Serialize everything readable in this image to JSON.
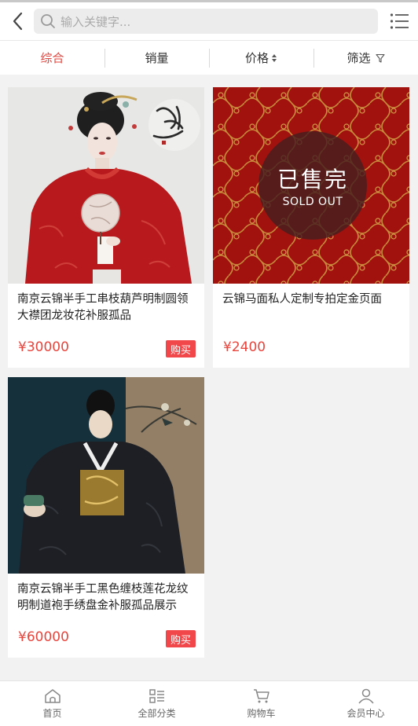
{
  "header": {
    "search_placeholder": "输入关键字..."
  },
  "sort": {
    "items": [
      "综合",
      "销量",
      "价格",
      "筛选"
    ],
    "active_color": "#e0463f"
  },
  "products": [
    {
      "title": "南京云锦半手工串枝葫芦明制圆领大襟团龙妆花补服孤品",
      "price": "¥30000",
      "buy_label": "购买"
    },
    {
      "title": "云锦马面私人定制专拍定金页面",
      "price": "¥2400",
      "sold_out_label": "已售完",
      "sold_out_en": "SOLD OUT"
    },
    {
      "title": "南京云锦半手工黑色缠枝莲花龙纹明制道袍手绣盘金补服孤品展示",
      "price": "¥60000",
      "buy_label": "购买"
    }
  ],
  "tabbar": {
    "items": [
      "首页",
      "全部分类",
      "购物车",
      "会员中心"
    ]
  },
  "colors": {
    "price": "#e8453d",
    "buy_button": "#f2474a"
  }
}
